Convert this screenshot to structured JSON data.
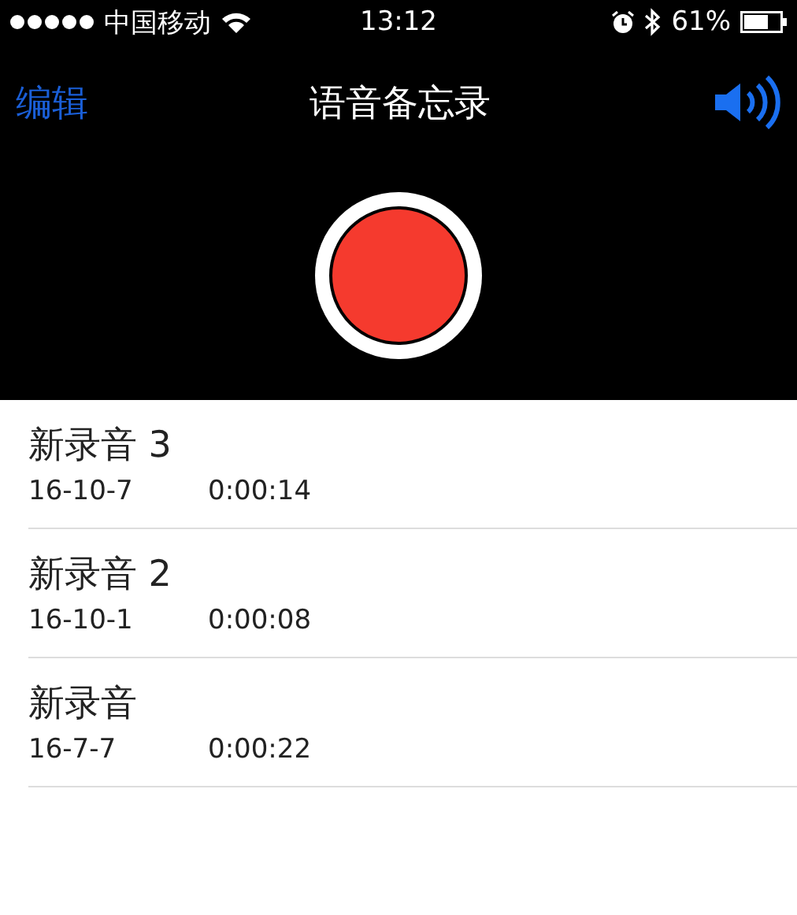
{
  "status_bar": {
    "carrier": "中国移动",
    "time": "13:12",
    "battery": "61%"
  },
  "nav_bar": {
    "edit": "编辑",
    "title": "语音备忘录"
  },
  "recordings": [
    {
      "name": "新录音 3",
      "date": "16-10-7",
      "duration": "0:00:14"
    },
    {
      "name": "新录音 2",
      "date": "16-10-1",
      "duration": "0:00:08"
    },
    {
      "name": "新录音",
      "date": "16-7-7",
      "duration": "0:00:22"
    }
  ]
}
